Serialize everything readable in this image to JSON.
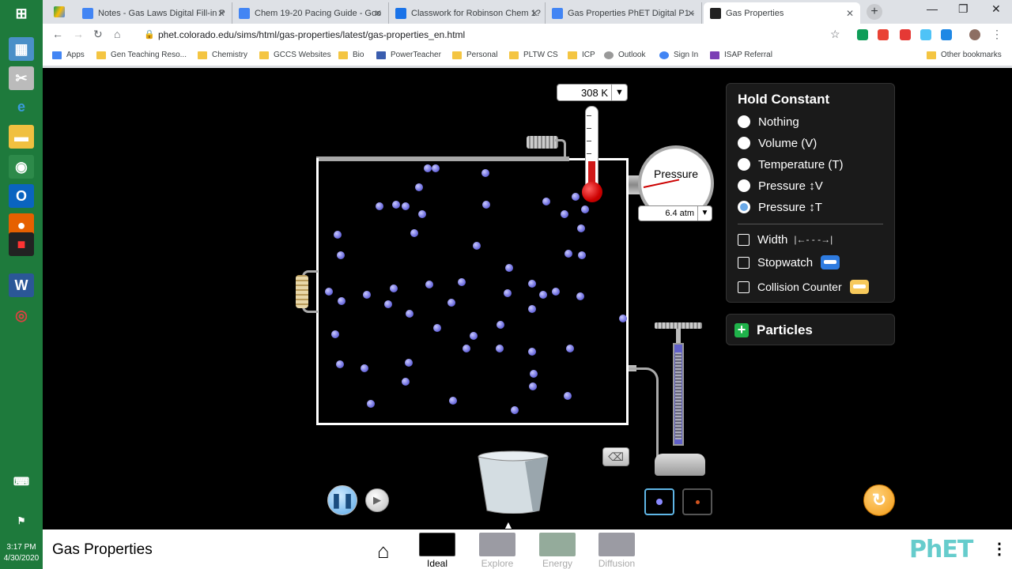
{
  "browser": {
    "tabs": [
      {
        "label": "Notes - Gas Laws Digital Fill-in P",
        "color": "#4285f4"
      },
      {
        "label": "Chem 19-20 Pacing Guide - Goo",
        "color": "#4285f4"
      },
      {
        "label": "Classwork for Robinson Chem 1?",
        "color": "#1a73e8"
      },
      {
        "label": "Gas Properties PhET Digital P1 - ",
        "color": "#4285f4"
      },
      {
        "label": "Gas Properties",
        "color": "#222222"
      }
    ],
    "url": "phet.colorado.edu/sims/html/gas-properties/latest/gas-properties_en.html",
    "bookmarks": [
      "Apps",
      "Gen Teaching Reso...",
      "Chemistry",
      "GCCS Websites",
      "Bio",
      "PowerTeacher",
      "Personal",
      "PLTW CS",
      "ICP",
      "Outlook",
      "Sign In",
      "ISAP Referral"
    ],
    "other_bookmarks": "Other bookmarks"
  },
  "taskbar": {
    "time": "3:17 PM",
    "date": "4/30/2020"
  },
  "sim": {
    "temperature": "308 K",
    "pressure_label": "Pressure",
    "pressure": "6.4 atm",
    "hold_constant": {
      "title": "Hold Constant",
      "options": [
        "Nothing",
        "Volume (V)",
        "Temperature (T)",
        "Pressure ↕V",
        "Pressure ↕T"
      ],
      "selected": "Pressure ↕T"
    },
    "checkboxes": {
      "width": "Width",
      "width_icon": "|←- - -→|",
      "stopwatch": "Stopwatch",
      "collision_counter": "Collision Counter"
    },
    "particles_panel": "Particles",
    "accent_colors": {
      "particle": "#7070e0",
      "selected": "#5fb6e6",
      "reset": "#f39b16"
    }
  },
  "navbar": {
    "title": "Gas Properties",
    "screens": [
      "Ideal",
      "Explore",
      "Energy",
      "Diffusion"
    ],
    "active_screen": "Ideal",
    "logo": "PhET",
    "menu": "⋮"
  }
}
